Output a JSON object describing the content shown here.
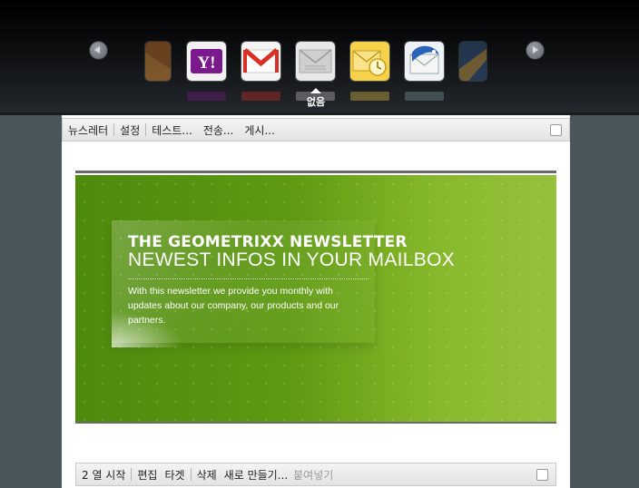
{
  "carousel": {
    "selected_label": "없음",
    "tiles": [
      {
        "name": "partial-tile-left-icon"
      },
      {
        "name": "yahoo-mail-icon",
        "text": "Y!"
      },
      {
        "name": "gmail-icon"
      },
      {
        "name": "plain-mail-icon"
      },
      {
        "name": "outlook-icon"
      },
      {
        "name": "thunderbird-icon"
      },
      {
        "name": "partial-tile-right-icon"
      }
    ]
  },
  "top_toolbar": {
    "items": [
      "뉴스레터",
      "설정",
      "테스트...",
      "전송...",
      "게시..."
    ]
  },
  "newsletter": {
    "title": "THE GEOMETRIXX NEWSLETTER",
    "subtitle": "NEWEST INFOS IN YOUR MAILBOX",
    "body": "With this newsletter we provide you monthly with updates about our company, our products and our partners."
  },
  "bottom_toolbar": {
    "items": [
      "2 열 시작",
      "편집",
      "타겟",
      "삭제",
      "새로 만들기...",
      "붙여넣기"
    ]
  },
  "colors": {
    "banner_dark": "#4e8a0c",
    "banner_light": "#97c13d",
    "page_bg": "#4a565c"
  }
}
